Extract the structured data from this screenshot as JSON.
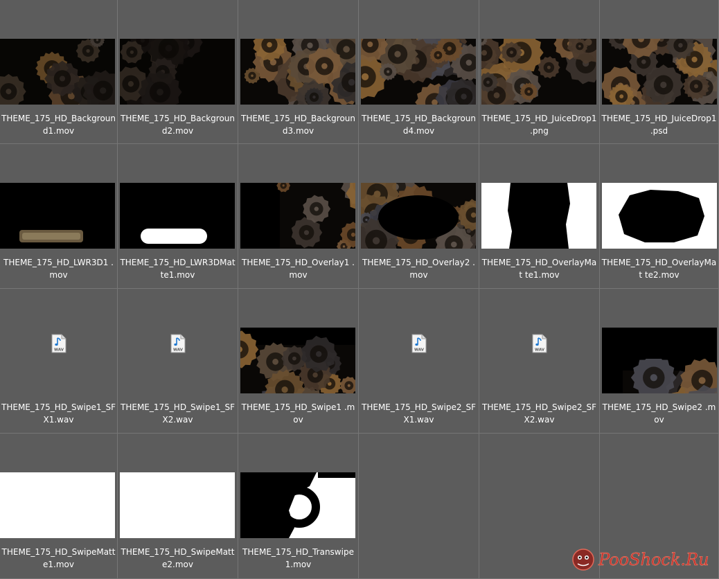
{
  "files": [
    {
      "name": "THEME_175_HD_Backgroun d1.mov",
      "kind": "gears-dark"
    },
    {
      "name": "THEME_175_HD_Backgroun d2.mov",
      "kind": "gears-darker"
    },
    {
      "name": "THEME_175_HD_Backgroun d3.mov",
      "kind": "gears"
    },
    {
      "name": "THEME_175_HD_Backgroun d4.mov",
      "kind": "gears"
    },
    {
      "name": "THEME_175_HD_JuiceDrop1 .png",
      "kind": "gears-warm"
    },
    {
      "name": "THEME_175_HD_JuiceDrop1 .psd",
      "kind": "gears-warm"
    },
    {
      "name": "THEME_175_HD_LWR3D1 .mov",
      "kind": "lower-third"
    },
    {
      "name": "THEME_175_HD_LWR3DMat te1.mov",
      "kind": "lower-third-matte"
    },
    {
      "name": "THEME_175_HD_Overlay1 .mov",
      "kind": "overlay-sides"
    },
    {
      "name": "THEME_175_HD_Overlay2 .mov",
      "kind": "overlay-frame"
    },
    {
      "name": "THEME_175_HD_OverlayMat te1.mov",
      "kind": "matte-sides"
    },
    {
      "name": "THEME_175_HD_OverlayMat te2.mov",
      "kind": "matte-frame"
    },
    {
      "name": "THEME_175_HD_Swipe1_SF X1.wav",
      "kind": "wav"
    },
    {
      "name": "THEME_175_HD_Swipe1_SF X2.wav",
      "kind": "wav"
    },
    {
      "name": "THEME_175_HD_Swipe1 .mov",
      "kind": "swipe-top"
    },
    {
      "name": "THEME_175_HD_Swipe2_SF X1.wav",
      "kind": "wav"
    },
    {
      "name": "THEME_175_HD_Swipe2_SF X2.wav",
      "kind": "wav"
    },
    {
      "name": "THEME_175_HD_Swipe2 .mov",
      "kind": "swipe-bottom"
    },
    {
      "name": "THEME_175_HD_SwipeMatt e1.mov",
      "kind": "white"
    },
    {
      "name": "THEME_175_HD_SwipeMatt e2.mov",
      "kind": "white"
    },
    {
      "name": "THEME_175_HD_Transwipe 1.mov",
      "kind": "transwipe"
    }
  ],
  "wav_icon_label": "WAV",
  "watermark": {
    "text": "PooShock.Ru",
    "color": "#c4302b"
  },
  "colors": {
    "background": "#5c5c5c",
    "grid_line": "#767676",
    "label": "#ffffff"
  }
}
